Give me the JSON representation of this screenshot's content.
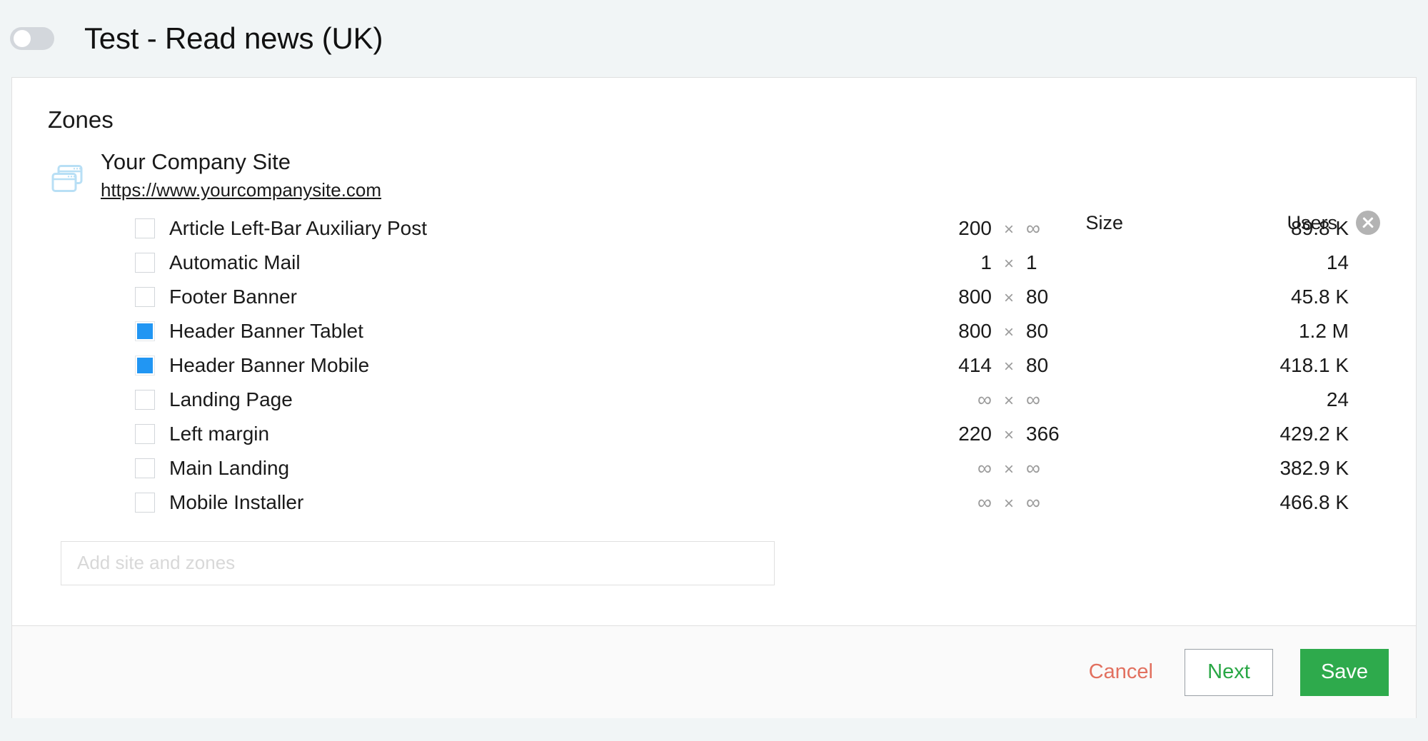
{
  "header": {
    "toggle_state": "off",
    "title": "Test - Read news (UK)"
  },
  "main": {
    "section_title": "Zones",
    "site": {
      "icon": "stacked-windows-icon",
      "name": "Your Company Site",
      "url": "https://www.yourcompanysite.com",
      "close_icon": "close-circle-icon"
    },
    "columns": {
      "size": "Size",
      "users": "Users"
    },
    "zones": [
      {
        "name": "Article Left-Bar Auxiliary Post",
        "checked": false,
        "width": "200",
        "x": "×",
        "height": "∞",
        "users": "89.8 K"
      },
      {
        "name": "Automatic Mail",
        "checked": false,
        "width": "1",
        "x": "×",
        "height": "1",
        "users": "14"
      },
      {
        "name": "Footer Banner",
        "checked": false,
        "width": "800",
        "x": "×",
        "height": "80",
        "users": "45.8 K"
      },
      {
        "name": "Header Banner Tablet",
        "checked": true,
        "width": "800",
        "x": "×",
        "height": "80",
        "users": "1.2 M"
      },
      {
        "name": "Header Banner Mobile",
        "checked": true,
        "width": "414",
        "x": "×",
        "height": "80",
        "users": "418.1 K"
      },
      {
        "name": "Landing Page",
        "checked": false,
        "width": "∞",
        "x": "×",
        "height": "∞",
        "users": "24"
      },
      {
        "name": "Left margin",
        "checked": false,
        "width": "220",
        "x": "×",
        "height": "366",
        "users": "429.2 K"
      },
      {
        "name": "Main Landing",
        "checked": false,
        "width": "∞",
        "x": "×",
        "height": "∞",
        "users": "382.9 K"
      },
      {
        "name": "Mobile Installer",
        "checked": false,
        "width": "∞",
        "x": "×",
        "height": "∞",
        "users": "466.8 K"
      }
    ],
    "add_input": {
      "value": "",
      "placeholder": "Add site and zones"
    }
  },
  "footer": {
    "cancel_label": "Cancel",
    "next_label": "Next",
    "save_label": "Save"
  },
  "colors": {
    "page_bg": "#f1f5f6",
    "checkbox_checked": "#2196f3",
    "save_green": "#2eaa4c",
    "next_green": "#29a745",
    "cancel_red": "#e2705f",
    "site_icon_blue": "#b8dff5",
    "close_gray": "#b3b3b3"
  }
}
